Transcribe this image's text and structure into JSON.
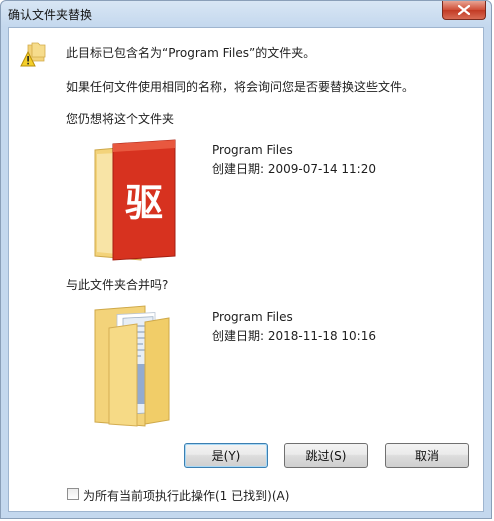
{
  "window": {
    "title": "确认文件夹替换"
  },
  "message": {
    "line1": "此目标已包含名为“Program Files”的文件夹。",
    "line2": "如果任何文件使用相同的名称，将会询问您是否要替换这些文件。",
    "line3": "您仍想将这个文件夹"
  },
  "source_folder": {
    "name": "Program Files",
    "created": "创建日期: 2009-07-14 11:20",
    "icon_glyph": "驱"
  },
  "merge_question": "与此文件夹合并吗?",
  "dest_folder": {
    "name": "Program Files",
    "created": "创建日期: 2018-11-18 10:16"
  },
  "buttons": {
    "yes": "是(Y)",
    "skip": "跳过(S)",
    "cancel": "取消"
  },
  "apply_all": {
    "checked": false,
    "label": "为所有当前项执行此操作(1 已找到)(A)"
  },
  "colors": {
    "folder_body": "#f3d37a",
    "folder_red_cover": "#d7321f",
    "accent_border": "#3c7fb1"
  }
}
